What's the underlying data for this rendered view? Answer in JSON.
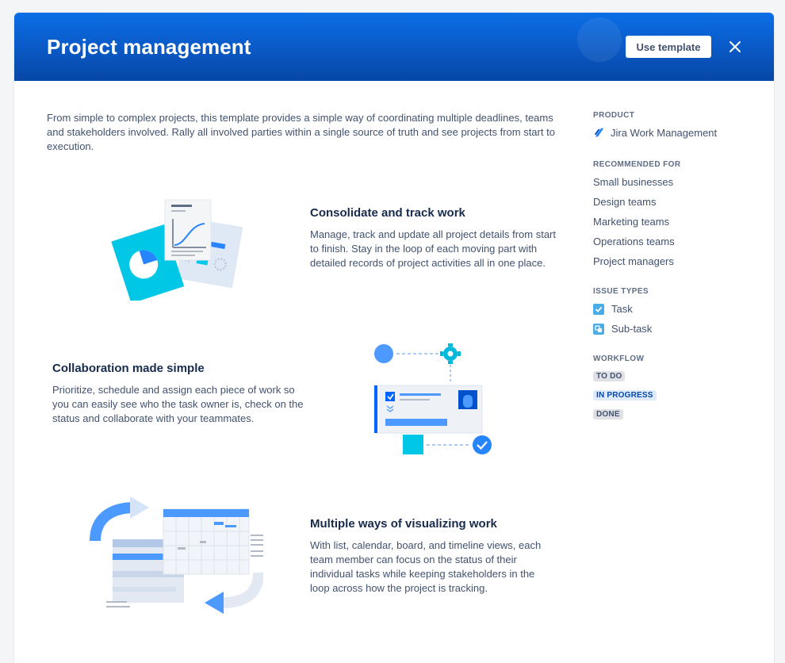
{
  "header": {
    "title": "Project management",
    "use_template_label": "Use template",
    "close_icon": "close-icon"
  },
  "intro": "From simple to complex projects, this template provides a simple way of coordinating multiple deadlines, teams and stakeholders involved. Rally all involved parties within a single source of truth and see projects from start to execution.",
  "features": [
    {
      "title": "Consolidate and track work",
      "description": "Manage, track and update all project details from start to finish. Stay in the loop of each moving part with detailed records of project activities all in one place.",
      "illustration": "documents-chart-illustration"
    },
    {
      "title": "Collaboration made simple",
      "description": "Prioritize, schedule and assign each piece of work so you can easily see who the task owner is, check on the status and collaborate with your teammates.",
      "illustration": "task-card-collaboration-illustration"
    },
    {
      "title": "Multiple ways of visualizing work",
      "description": "With list, calendar, board, and timeline views, each team member can focus on the status of their individual tasks while keeping stakeholders in the loop across how the project is tracking.",
      "illustration": "calendar-timeline-illustration"
    }
  ],
  "sidebar": {
    "product": {
      "title": "PRODUCT",
      "name": "Jira Work Management",
      "icon": "jira-work-management-icon"
    },
    "recommended": {
      "title": "RECOMMENDED FOR",
      "items": [
        "Small businesses",
        "Design teams",
        "Marketing teams",
        "Operations teams",
        "Project managers"
      ]
    },
    "issue_types": {
      "title": "ISSUE TYPES",
      "items": [
        {
          "label": "Task",
          "icon": "task-icon",
          "color": "#4bade8"
        },
        {
          "label": "Sub-task",
          "icon": "subtask-icon",
          "color": "#4bade8"
        }
      ]
    },
    "workflow": {
      "title": "WORKFLOW",
      "statuses": [
        "TO DO",
        "IN PROGRESS",
        "DONE"
      ]
    }
  },
  "colors": {
    "header_blue": "#0a58c4",
    "accent_cyan": "#00c7e6",
    "accent_blue": "#2684ff",
    "text_dark": "#172b4d",
    "text_muted": "#42526e"
  }
}
